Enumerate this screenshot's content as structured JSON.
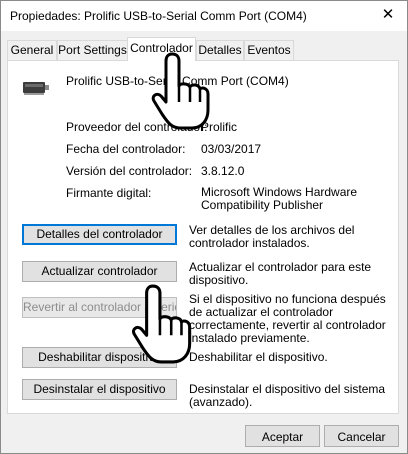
{
  "window": {
    "title": "Propiedades: Prolific USB-to-Serial Comm Port (COM4)",
    "close_symbol": "✕"
  },
  "tabs": [
    {
      "label": "General",
      "active": false
    },
    {
      "label": "Port Settings",
      "active": false
    },
    {
      "label": "Controlador",
      "active": true
    },
    {
      "label": "Detalles",
      "active": false
    },
    {
      "label": "Eventos",
      "active": false
    }
  ],
  "device": {
    "icon": "usb-serial-adapter-icon",
    "name": "Prolific USB-to-Serial Comm Port (COM4)"
  },
  "driver_info": [
    {
      "label": "Proveedor del controlador:",
      "value": "Prolific"
    },
    {
      "label": "Fecha del controlador:",
      "value": "03/03/2017"
    },
    {
      "label": "Versión del controlador:",
      "value": "3.8.12.0"
    },
    {
      "label": "Firmante digital:",
      "value": "Microsoft Windows Hardware Compatibility Publisher"
    }
  ],
  "actions": [
    {
      "button": "Detalles del controlador",
      "description": "Ver detalles de los archivos del controlador instalados.",
      "enabled": true
    },
    {
      "button": "Actualizar controlador",
      "description": "Actualizar el controlador para este dispositivo.",
      "enabled": true
    },
    {
      "button": "Revertir al controlador anterior",
      "description": "Si el dispositivo no funciona después de actualizar el controlador correctamente, revertir al controlador instalado previamente.",
      "enabled": false
    },
    {
      "button": "Deshabilitar dispositivo",
      "description": "Deshabilitar el dispositivo.",
      "enabled": true
    },
    {
      "button": "Desinstalar el dispositivo",
      "description": "Desinstalar el dispositivo del sistema (avanzado).",
      "enabled": true
    }
  ],
  "footer": {
    "ok_label": "Aceptar",
    "cancel_label": "Cancelar"
  },
  "colors": {
    "focus_border": "#0078d7",
    "disabled_text": "#8c8c8c"
  }
}
